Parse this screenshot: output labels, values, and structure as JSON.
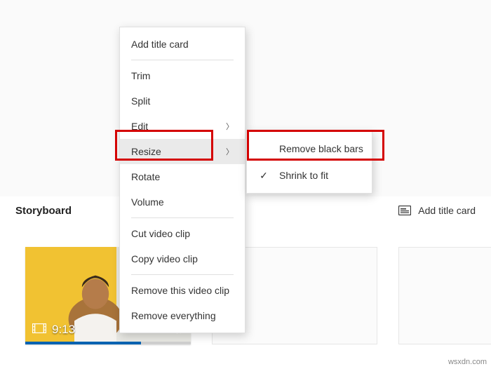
{
  "storyboard": {
    "title": "Storyboard",
    "add_title_card_label": "Add title card",
    "clip": {
      "duration": "9:13"
    }
  },
  "context_menu": {
    "items": [
      {
        "label": "Add title card",
        "has_submenu": false
      },
      {
        "label": "Trim",
        "has_submenu": false
      },
      {
        "label": "Split",
        "has_submenu": false
      },
      {
        "label": "Edit",
        "has_submenu": true
      },
      {
        "label": "Resize",
        "has_submenu": true,
        "hover": true
      },
      {
        "label": "Rotate",
        "has_submenu": false
      },
      {
        "label": "Volume",
        "has_submenu": false
      },
      {
        "label": "Cut video clip",
        "has_submenu": false
      },
      {
        "label": "Copy video clip",
        "has_submenu": false
      },
      {
        "label": "Remove this video clip",
        "has_submenu": false
      },
      {
        "label": "Remove everything",
        "has_submenu": false
      }
    ],
    "submenu": {
      "items": [
        {
          "label": "Remove black bars",
          "checked": false
        },
        {
          "label": "Shrink to fit",
          "checked": true
        }
      ]
    }
  },
  "watermark": "wsxdn.com"
}
